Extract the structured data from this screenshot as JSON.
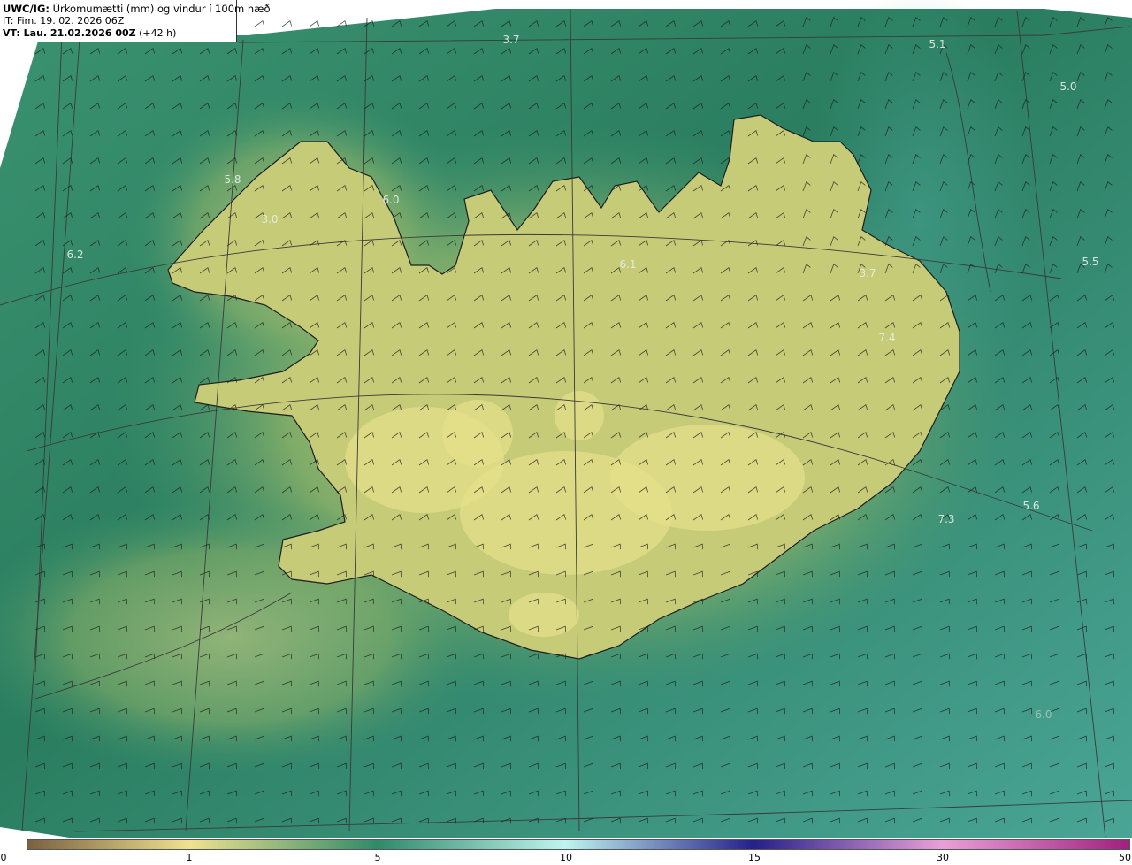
{
  "header": {
    "code": "UWC/IG:",
    "title": "Úrkomumætti (mm) og vindur í 100m hæð",
    "issue_time": "IT: Fim. 19. 02. 2026 06Z",
    "valid_prefix": "VT: Lau. 21.02.2026 00Z",
    "valid_suffix": "(+42 h)"
  },
  "station_values": [
    {
      "text": "3.7"
    },
    {
      "text": "5.1"
    },
    {
      "text": "5.0"
    },
    {
      "text": "5.8"
    },
    {
      "text": "6.0"
    },
    {
      "text": "3.0"
    },
    {
      "text": "6.2"
    },
    {
      "text": "6.1"
    },
    {
      "text": "5.5"
    },
    {
      "text": "3.7"
    },
    {
      "text": "7.4"
    },
    {
      "text": "7.3"
    },
    {
      "text": "5.6"
    },
    {
      "text": "6.0"
    }
  ],
  "colorbar": {
    "ticks": [
      "0",
      "1",
      "5",
      "10",
      "15",
      "30",
      "50"
    ],
    "colors": {
      "c0": "#7a6040",
      "c1": "#efe28e",
      "c5": "#2f8a6a",
      "c10": "#bff4f0",
      "c15": "#25208a",
      "c30": "#e9a0d8",
      "c50": "#a0207e"
    }
  },
  "map_colors": {
    "sea_deep": "#2a7d5f",
    "sea_mid": "#3a9270",
    "sea_teal": "#4aa596",
    "land_low": "#8fb46a",
    "land_mid": "#c6cb78",
    "land_high": "#e4df8a",
    "coast": "#1e1e1e",
    "grid": "#3a3a3a",
    "barb": "#1c1c1c"
  }
}
